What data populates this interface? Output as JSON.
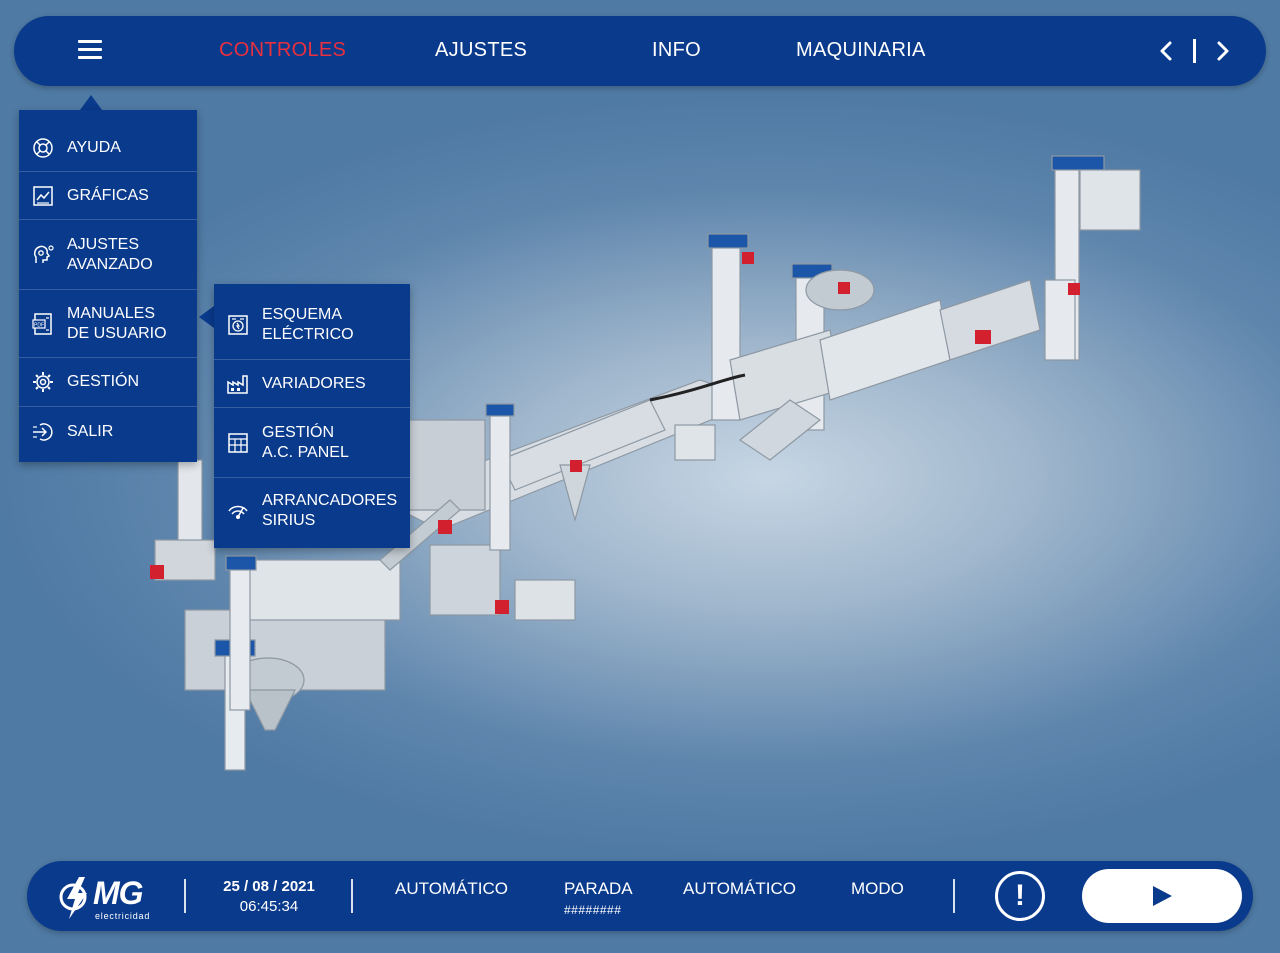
{
  "colors": {
    "primary": "#0a3a8c",
    "active": "#e8303e",
    "text": "#ffffff"
  },
  "topbar": {
    "menu_icon": "hamburger-icon",
    "tabs": [
      {
        "label": "CONTROLES",
        "active": true
      },
      {
        "label": "AJUSTES",
        "active": false
      },
      {
        "label": "INFO",
        "active": false
      },
      {
        "label": "MAQUINARIA",
        "active": false
      }
    ],
    "prev_icon": "chevron-left-icon",
    "next_icon": "chevron-right-icon"
  },
  "menu": {
    "items": [
      {
        "label": "AYUDA",
        "icon": "help-icon"
      },
      {
        "label": "GRÁFICAS",
        "icon": "chart-icon"
      },
      {
        "label": "AJUSTES\nAVANZADO",
        "icon": "advanced-settings-icon"
      },
      {
        "label": "MANUALES\nDE USUARIO",
        "icon": "manual-icon"
      },
      {
        "label": "GESTIÓN",
        "icon": "gear-icon"
      },
      {
        "label": "SALIR",
        "icon": "exit-icon"
      }
    ]
  },
  "submenu": {
    "items": [
      {
        "label": "ESQUEMA\nELÉCTRICO",
        "icon": "electric-schema-icon"
      },
      {
        "label": "VARIADORES",
        "icon": "factory-icon"
      },
      {
        "label": "GESTIÓN\nA.C. PANEL",
        "icon": "panel-icon"
      },
      {
        "label": "ARRANCADORES\nSIRIUS",
        "icon": "starter-icon"
      }
    ]
  },
  "bottombar": {
    "logo_text": "MG",
    "logo_sub": "electricidad",
    "date": "25 / 08 / 2021",
    "time": "06:45:34",
    "status1": "AUTOMÁTICO",
    "status2": "PARADA",
    "status2_sub": "########",
    "status3": "AUTOMÁTICO",
    "status4": "MODO",
    "alert_symbol": "!",
    "alert_icon": "alert-icon",
    "play_icon": "play-icon"
  }
}
